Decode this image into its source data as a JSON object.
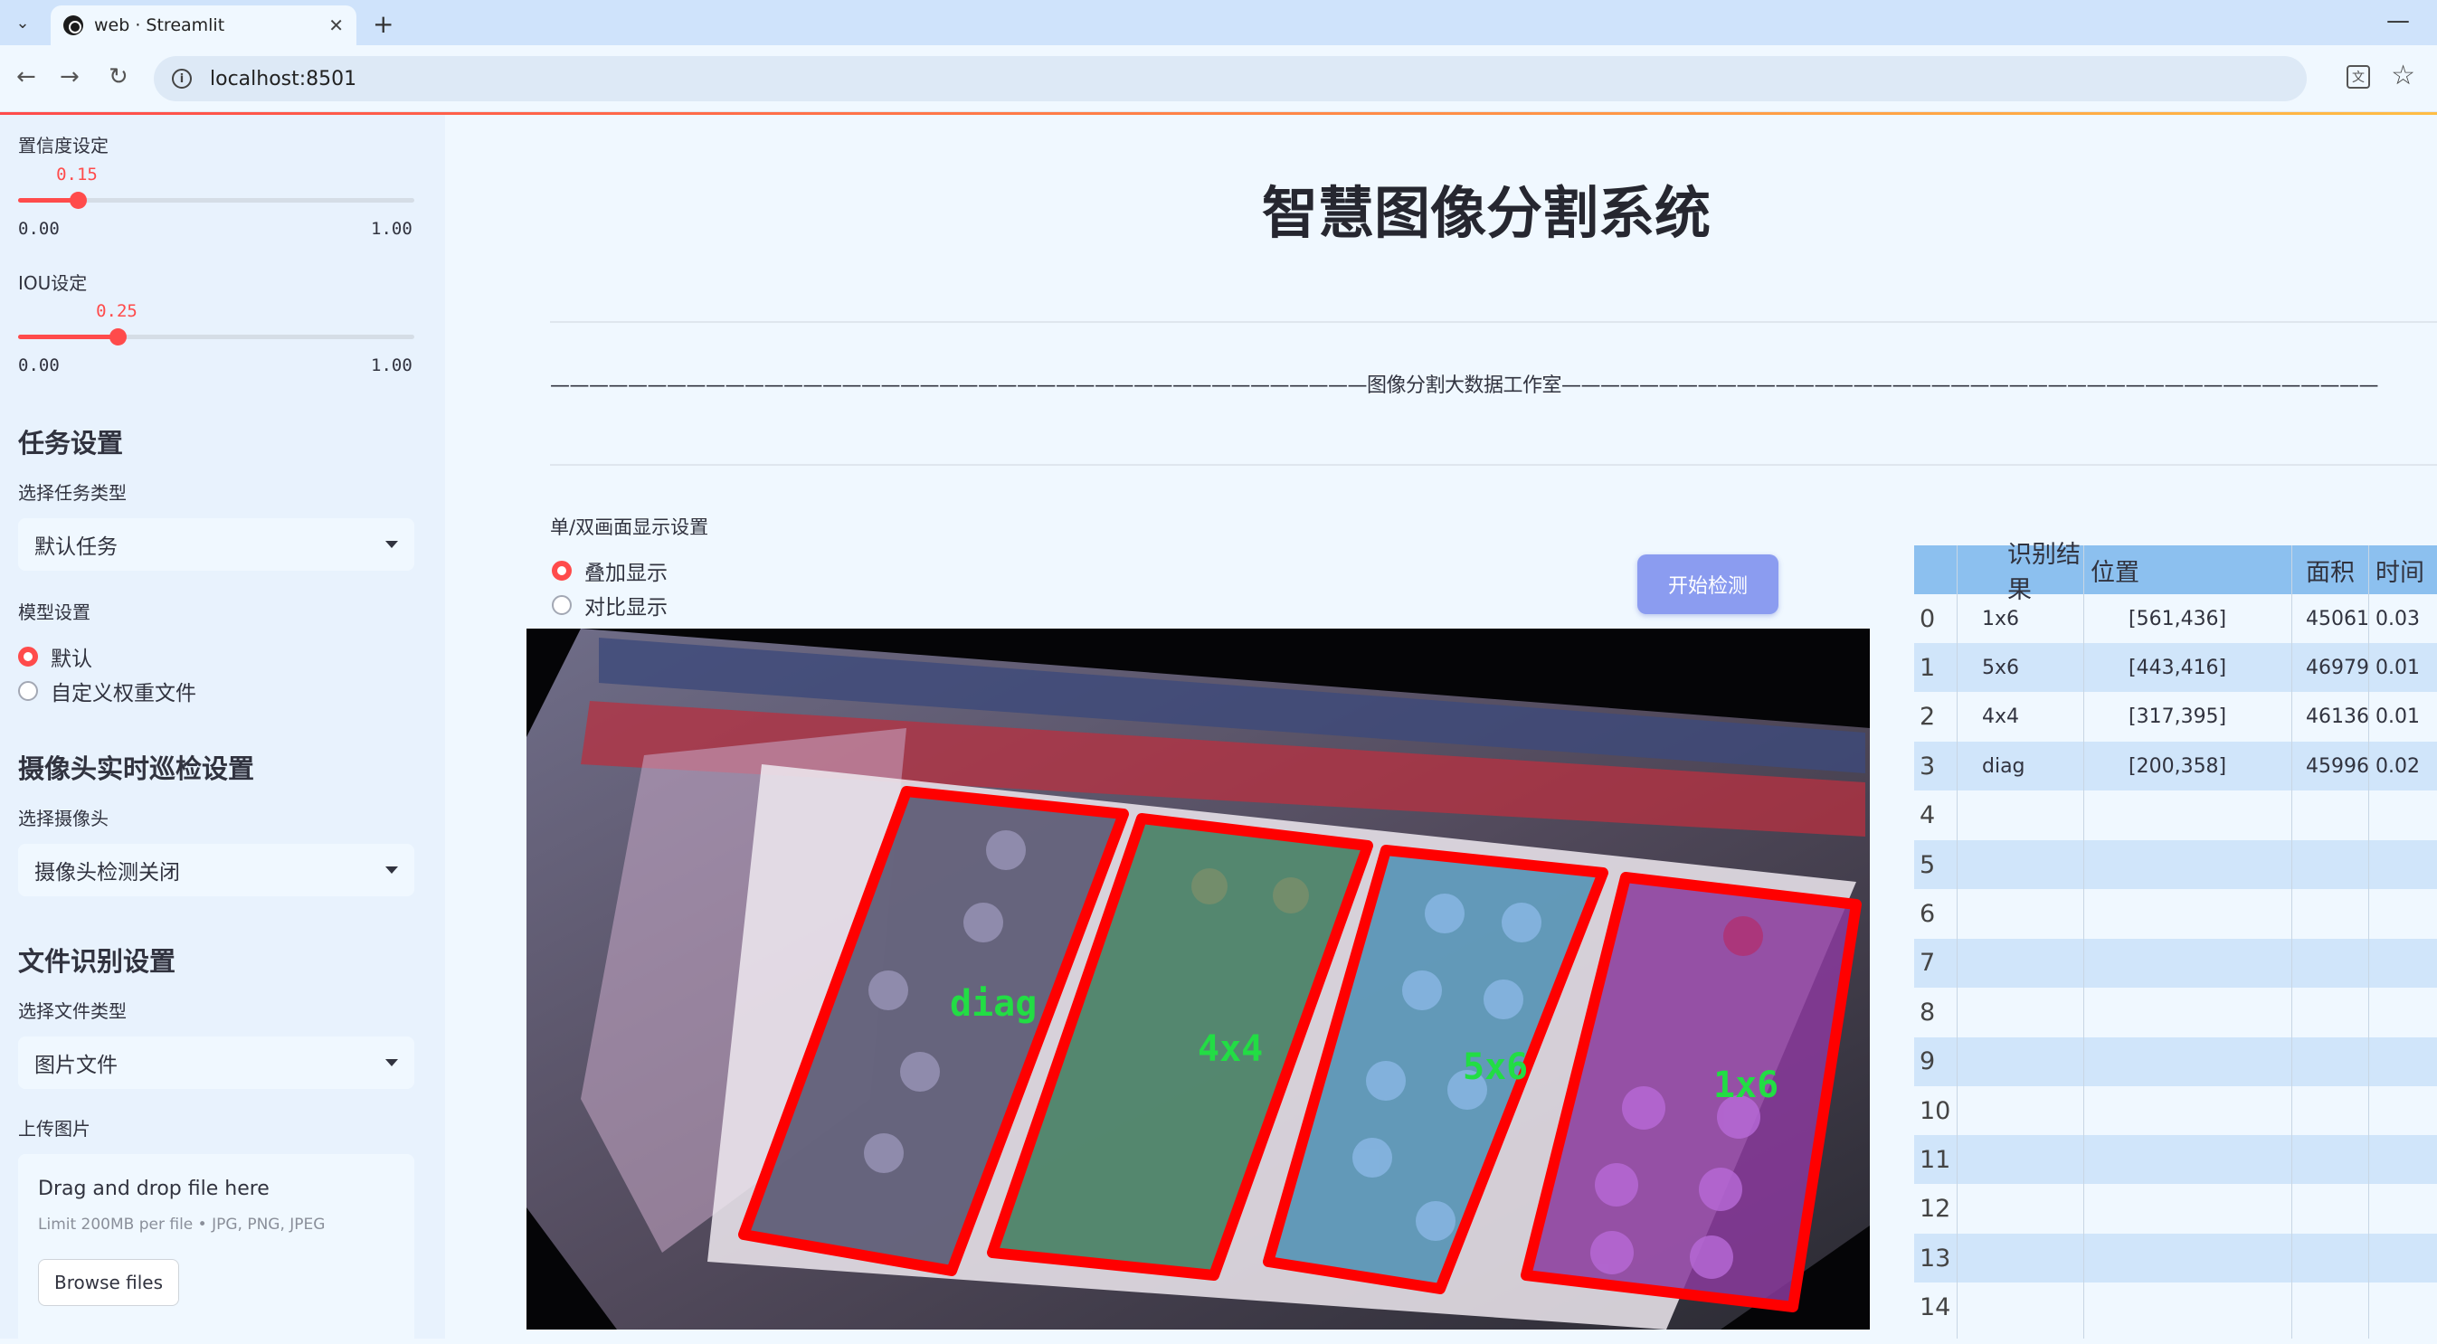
{
  "browser": {
    "tab_title": "web · Streamlit",
    "url": "localhost:8501"
  },
  "sidebar": {
    "confidence": {
      "label": "置信度设定",
      "value": "0.15",
      "fraction": 0.15,
      "min": "0.00",
      "max": "1.00"
    },
    "iou": {
      "label": "IOU设定",
      "value": "0.25",
      "fraction": 0.25,
      "min": "0.00",
      "max": "1.00"
    },
    "task_section": "任务设置",
    "task_type_label": "选择任务类型",
    "task_type_value": "默认任务",
    "model_label": "模型设置",
    "model_options": [
      "默认",
      "自定义权重文件"
    ],
    "camera_section": "摄像头实时巡检设置",
    "camera_label": "选择摄像头",
    "camera_value": "摄像头检测关闭",
    "file_section": "文件识别设置",
    "file_type_label": "选择文件类型",
    "file_type_value": "图片文件",
    "upload_label": "上传图片",
    "upload_title": "Drag and drop file here",
    "upload_limit": "Limit 200MB per file • JPG, PNG, JPEG",
    "browse_label": "Browse files"
  },
  "main": {
    "title": "智慧图像分割系统",
    "subtitle_line": "——————————————————————————————————————————图像分割大数据工作室——————————————————————————————————————————",
    "display_label": "单/双画面显示设置",
    "display_options": [
      "叠加显示",
      "对比显示"
    ],
    "start_button": "开始检测",
    "detections": [
      "diag",
      "4x4",
      "5x6",
      "1x6"
    ]
  },
  "table": {
    "headers": [
      "识别结果",
      "位置",
      "面积",
      "时间"
    ],
    "rows": [
      {
        "idx": "0",
        "result": "1x6",
        "pos": "[561,436]",
        "area": "45061",
        "time": "0.03"
      },
      {
        "idx": "1",
        "result": "5x6",
        "pos": "[443,416]",
        "area": "46979",
        "time": "0.01"
      },
      {
        "idx": "2",
        "result": "4x4",
        "pos": "[317,395]",
        "area": "46136",
        "time": "0.01"
      },
      {
        "idx": "3",
        "result": "diag",
        "pos": "[200,358]",
        "area": "45996",
        "time": "0.02"
      },
      {
        "idx": "4",
        "result": "",
        "pos": "",
        "area": "",
        "time": ""
      },
      {
        "idx": "5",
        "result": "",
        "pos": "",
        "area": "",
        "time": ""
      },
      {
        "idx": "6",
        "result": "",
        "pos": "",
        "area": "",
        "time": ""
      },
      {
        "idx": "7",
        "result": "",
        "pos": "",
        "area": "",
        "time": ""
      },
      {
        "idx": "8",
        "result": "",
        "pos": "",
        "area": "",
        "time": ""
      },
      {
        "idx": "9",
        "result": "",
        "pos": "",
        "area": "",
        "time": ""
      },
      {
        "idx": "10",
        "result": "",
        "pos": "",
        "area": "",
        "time": ""
      },
      {
        "idx": "11",
        "result": "",
        "pos": "",
        "area": "",
        "time": ""
      },
      {
        "idx": "12",
        "result": "",
        "pos": "",
        "area": "",
        "time": ""
      },
      {
        "idx": "13",
        "result": "",
        "pos": "",
        "area": "",
        "time": ""
      },
      {
        "idx": "14",
        "result": "",
        "pos": "",
        "area": "",
        "time": ""
      }
    ]
  }
}
